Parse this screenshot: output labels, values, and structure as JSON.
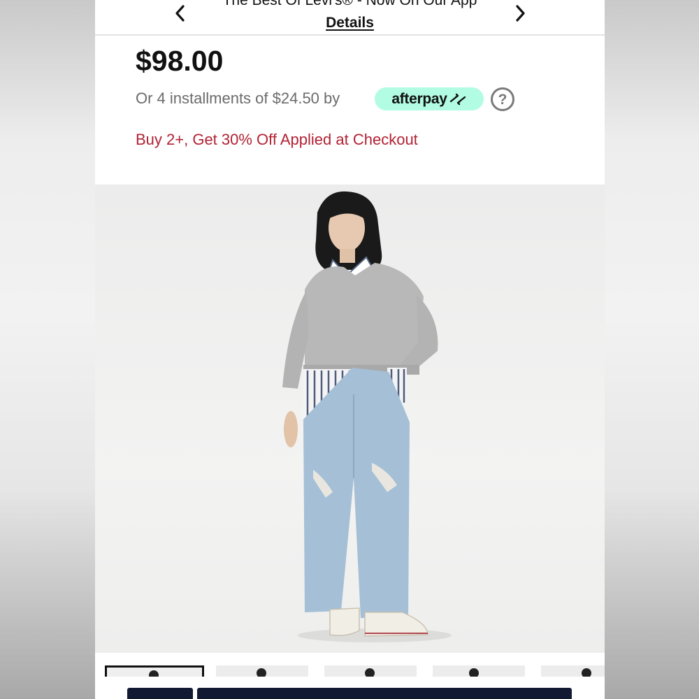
{
  "promo_banner": {
    "text": "The Best Of Levi's® - Now On Our App",
    "link_label": "Details",
    "prev_icon": "chevron-left-icon",
    "next_icon": "chevron-right-icon"
  },
  "product": {
    "price": "$98.00",
    "installments_text": "Or 4 installments of $24.50 by",
    "afterpay_label": "afterpay",
    "afterpay_color": "#b2fce4",
    "help_symbol": "?",
    "promo_message": "Buy 2+, Get 30% Off Applied at Checkout",
    "promo_color": "#b22234"
  },
  "gallery": {
    "thumbnail_count": 5,
    "active_thumbnail": 1
  },
  "colors": {
    "button_navy": "#121a33",
    "text": "#111111"
  }
}
